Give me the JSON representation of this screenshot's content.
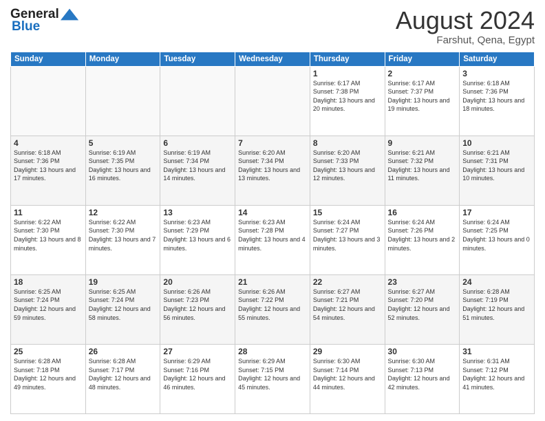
{
  "header": {
    "logo": {
      "general": "General",
      "blue": "Blue"
    },
    "month": "August 2024",
    "location": "Farshut, Qena, Egypt"
  },
  "days_of_week": [
    "Sunday",
    "Monday",
    "Tuesday",
    "Wednesday",
    "Thursday",
    "Friday",
    "Saturday"
  ],
  "weeks": [
    [
      {
        "day": "",
        "info": ""
      },
      {
        "day": "",
        "info": ""
      },
      {
        "day": "",
        "info": ""
      },
      {
        "day": "",
        "info": ""
      },
      {
        "day": "1",
        "info": "Sunrise: 6:17 AM\nSunset: 7:38 PM\nDaylight: 13 hours and 20 minutes."
      },
      {
        "day": "2",
        "info": "Sunrise: 6:17 AM\nSunset: 7:37 PM\nDaylight: 13 hours and 19 minutes."
      },
      {
        "day": "3",
        "info": "Sunrise: 6:18 AM\nSunset: 7:36 PM\nDaylight: 13 hours and 18 minutes."
      }
    ],
    [
      {
        "day": "4",
        "info": "Sunrise: 6:18 AM\nSunset: 7:36 PM\nDaylight: 13 hours and 17 minutes."
      },
      {
        "day": "5",
        "info": "Sunrise: 6:19 AM\nSunset: 7:35 PM\nDaylight: 13 hours and 16 minutes."
      },
      {
        "day": "6",
        "info": "Sunrise: 6:19 AM\nSunset: 7:34 PM\nDaylight: 13 hours and 14 minutes."
      },
      {
        "day": "7",
        "info": "Sunrise: 6:20 AM\nSunset: 7:34 PM\nDaylight: 13 hours and 13 minutes."
      },
      {
        "day": "8",
        "info": "Sunrise: 6:20 AM\nSunset: 7:33 PM\nDaylight: 13 hours and 12 minutes."
      },
      {
        "day": "9",
        "info": "Sunrise: 6:21 AM\nSunset: 7:32 PM\nDaylight: 13 hours and 11 minutes."
      },
      {
        "day": "10",
        "info": "Sunrise: 6:21 AM\nSunset: 7:31 PM\nDaylight: 13 hours and 10 minutes."
      }
    ],
    [
      {
        "day": "11",
        "info": "Sunrise: 6:22 AM\nSunset: 7:30 PM\nDaylight: 13 hours and 8 minutes."
      },
      {
        "day": "12",
        "info": "Sunrise: 6:22 AM\nSunset: 7:30 PM\nDaylight: 13 hours and 7 minutes."
      },
      {
        "day": "13",
        "info": "Sunrise: 6:23 AM\nSunset: 7:29 PM\nDaylight: 13 hours and 6 minutes."
      },
      {
        "day": "14",
        "info": "Sunrise: 6:23 AM\nSunset: 7:28 PM\nDaylight: 13 hours and 4 minutes."
      },
      {
        "day": "15",
        "info": "Sunrise: 6:24 AM\nSunset: 7:27 PM\nDaylight: 13 hours and 3 minutes."
      },
      {
        "day": "16",
        "info": "Sunrise: 6:24 AM\nSunset: 7:26 PM\nDaylight: 13 hours and 2 minutes."
      },
      {
        "day": "17",
        "info": "Sunrise: 6:24 AM\nSunset: 7:25 PM\nDaylight: 13 hours and 0 minutes."
      }
    ],
    [
      {
        "day": "18",
        "info": "Sunrise: 6:25 AM\nSunset: 7:24 PM\nDaylight: 12 hours and 59 minutes."
      },
      {
        "day": "19",
        "info": "Sunrise: 6:25 AM\nSunset: 7:24 PM\nDaylight: 12 hours and 58 minutes."
      },
      {
        "day": "20",
        "info": "Sunrise: 6:26 AM\nSunset: 7:23 PM\nDaylight: 12 hours and 56 minutes."
      },
      {
        "day": "21",
        "info": "Sunrise: 6:26 AM\nSunset: 7:22 PM\nDaylight: 12 hours and 55 minutes."
      },
      {
        "day": "22",
        "info": "Sunrise: 6:27 AM\nSunset: 7:21 PM\nDaylight: 12 hours and 54 minutes."
      },
      {
        "day": "23",
        "info": "Sunrise: 6:27 AM\nSunset: 7:20 PM\nDaylight: 12 hours and 52 minutes."
      },
      {
        "day": "24",
        "info": "Sunrise: 6:28 AM\nSunset: 7:19 PM\nDaylight: 12 hours and 51 minutes."
      }
    ],
    [
      {
        "day": "25",
        "info": "Sunrise: 6:28 AM\nSunset: 7:18 PM\nDaylight: 12 hours and 49 minutes."
      },
      {
        "day": "26",
        "info": "Sunrise: 6:28 AM\nSunset: 7:17 PM\nDaylight: 12 hours and 48 minutes."
      },
      {
        "day": "27",
        "info": "Sunrise: 6:29 AM\nSunset: 7:16 PM\nDaylight: 12 hours and 46 minutes."
      },
      {
        "day": "28",
        "info": "Sunrise: 6:29 AM\nSunset: 7:15 PM\nDaylight: 12 hours and 45 minutes."
      },
      {
        "day": "29",
        "info": "Sunrise: 6:30 AM\nSunset: 7:14 PM\nDaylight: 12 hours and 44 minutes."
      },
      {
        "day": "30",
        "info": "Sunrise: 6:30 AM\nSunset: 7:13 PM\nDaylight: 12 hours and 42 minutes."
      },
      {
        "day": "31",
        "info": "Sunrise: 6:31 AM\nSunset: 7:12 PM\nDaylight: 12 hours and 41 minutes."
      }
    ]
  ]
}
